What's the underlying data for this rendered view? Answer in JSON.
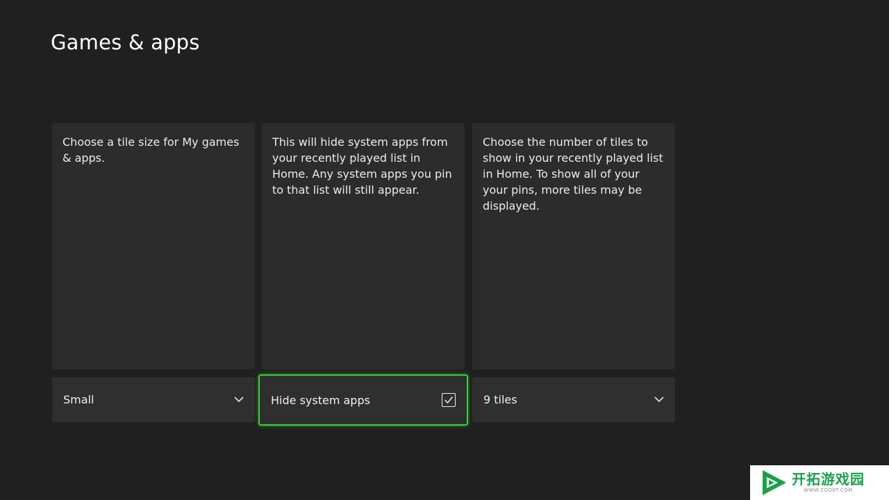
{
  "page": {
    "title": "Games & apps"
  },
  "cards": [
    {
      "description": "Choose a tile size for My games & apps.",
      "control_type": "dropdown",
      "value": "Small"
    },
    {
      "description": "This will hide system apps from your recently played list in Home. Any system apps you pin to that list will still appear.",
      "control_type": "checkbox",
      "value": "Hide system apps",
      "checked": true,
      "focused": true
    },
    {
      "description": "Choose the number of tiles to show in your recently played list in Home. To show all of your your pins, more tiles may be displayed.",
      "control_type": "dropdown",
      "value": "9 tiles"
    }
  ],
  "icons": {
    "dropdown": "chevron-down-icon",
    "checkbox": "checkmark-icon"
  },
  "colors": {
    "background": "#202020",
    "card": "#2c2c2c",
    "focus": "#3ad13a"
  },
  "watermark": {
    "title": "开拓游戏园",
    "url": "WWW.CDDKT.COM"
  }
}
